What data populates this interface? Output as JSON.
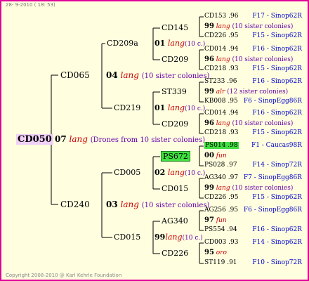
{
  "header_date": "28- 9-2010 ( 18: 53)",
  "watermark": "",
  "copyright": "Copyright 2008-2010 @ Karl Kehrle Foundation",
  "root": {
    "id": "CD050",
    "year": "07",
    "breed": "lang",
    "note": "(Drones from 10 sister colonies)"
  },
  "gen1": [
    {
      "id": "CD065",
      "year": "04",
      "breed": "lang",
      "note": "(10 sister colonies)"
    },
    {
      "id": "CD240",
      "year": "03",
      "breed": "lang",
      "note": "(10 sister colonies)"
    }
  ],
  "gen2": [
    {
      "id": "CD209a",
      "year": "01",
      "breed": "lang",
      "note": "(10 c.)"
    },
    {
      "id": "CD219",
      "year": "01",
      "breed": "lang",
      "note": "(10 c.)"
    },
    {
      "id": "CD005",
      "year": "02",
      "breed": "lang",
      "note": "(10 c.)"
    },
    {
      "id": "CD015",
      "year": "99",
      "breed": "lang",
      "note": "(10 c.)"
    }
  ],
  "gen3": [
    "CD145",
    "CD209",
    "ST339",
    "CD209",
    "PS672",
    "CD015",
    "AG340",
    "CD226"
  ],
  "gen4": [
    {
      "text": "CD153 .96",
      "right": "F17 - Sinop62R"
    },
    {
      "year": "99",
      "breed": "lang",
      "note": "(10 sister colonies)"
    },
    {
      "text": "CD226 .95",
      "right": "F15 - Sinop62R"
    },
    {
      "text": "CD014 .94",
      "right": "F16 - Sinop62R"
    },
    {
      "year": "96",
      "breed": "lang",
      "note": "(10 sister colonies)"
    },
    {
      "text": "CD218 .93",
      "right": "F15 - Sinop62R"
    },
    {
      "text": "ST233 .96",
      "right": "F16 - Sinop62R"
    },
    {
      "year": "99",
      "breed": "alr",
      "note": "(12 sister colonies)"
    },
    {
      "text": "KB008 .95",
      "right": "F6 - SinopEgg86R"
    },
    {
      "text": "CD014 .94",
      "right": "F16 - Sinop62R"
    },
    {
      "year": "96",
      "breed": "lang",
      "note": "(10 sister colonies)"
    },
    {
      "text": "CD218 .93",
      "right": "F15 - Sinop62R"
    },
    {
      "text": "PS014 .98",
      "right": "F1 - Caucas98R",
      "hl": true
    },
    {
      "year": "00",
      "breed": "fun",
      "note": ""
    },
    {
      "text": "PS028 .97",
      "right": "F14 - Sinop72R"
    },
    {
      "text": "AG340 .97",
      "right": "F7 - SinopEgg86R"
    },
    {
      "year": "99",
      "breed": "lang",
      "note": "(10 sister colonies)"
    },
    {
      "text": "CD226 .95",
      "right": "F15 - Sinop62R"
    },
    {
      "text": "AG256 .95",
      "right": "F6 - SinopEgg86R"
    },
    {
      "year": "97",
      "breed": "fun",
      "note": ""
    },
    {
      "text": "PS554 .94",
      "right": "F16 - Sinop62R"
    },
    {
      "text": "CD003 .93",
      "right": "F14 - Sinop62R"
    },
    {
      "year": "95",
      "breed": "oro",
      "note": ""
    },
    {
      "text": "ST119 .91",
      "right": "F10 - Sinop72R"
    }
  ]
}
